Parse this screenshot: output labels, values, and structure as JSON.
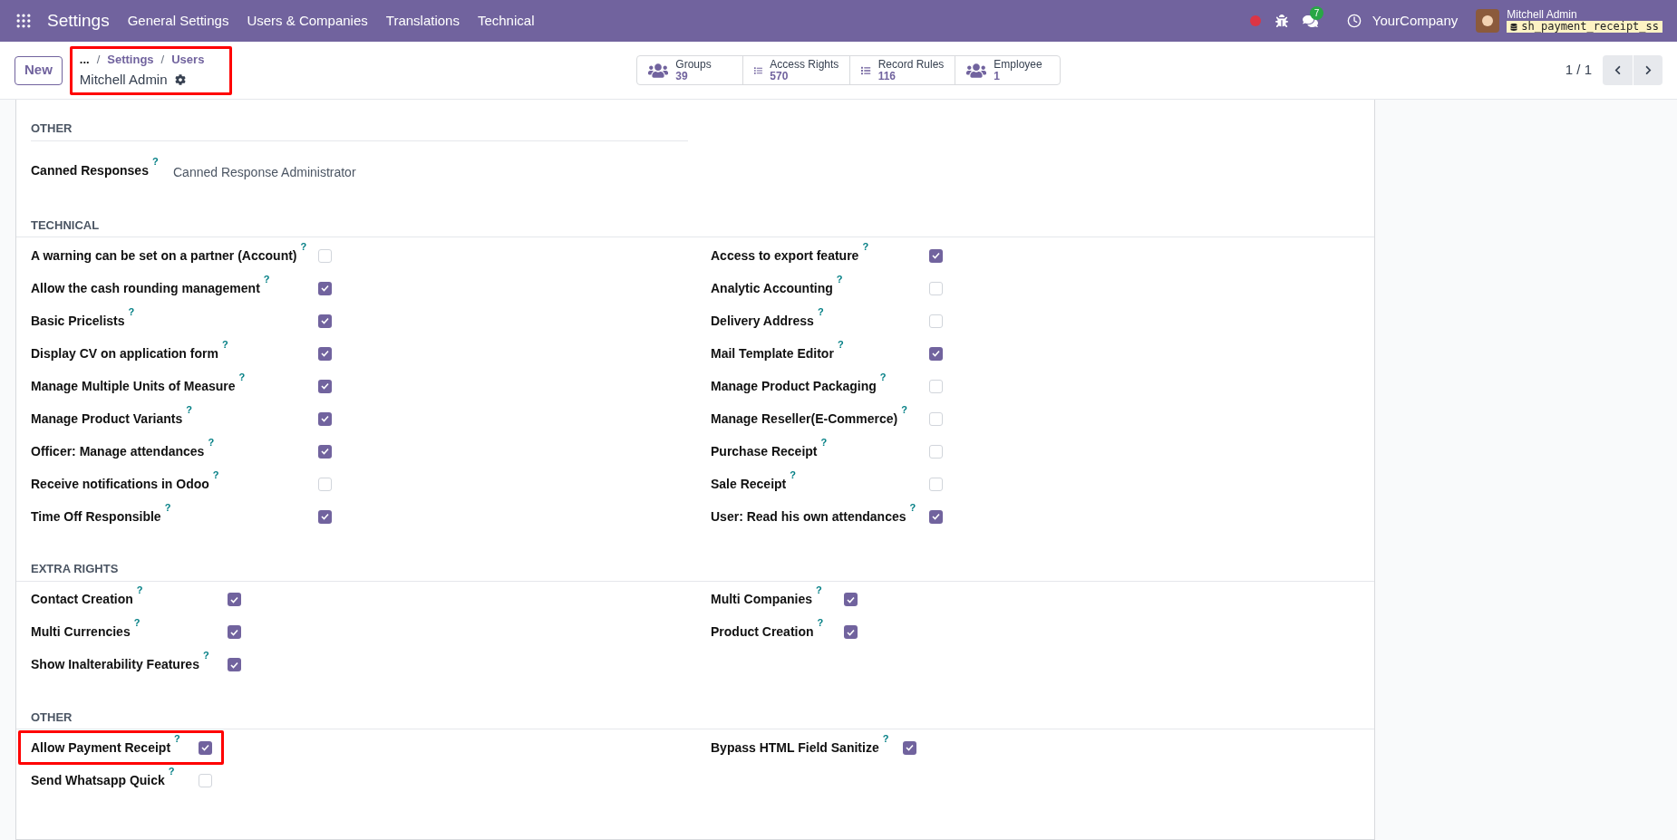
{
  "topbar": {
    "app": "Settings",
    "menu": [
      "General Settings",
      "Users & Companies",
      "Translations",
      "Technical"
    ],
    "chat_count": "7",
    "company": "YourCompany",
    "user": "Mitchell Admin",
    "database": "sh_payment_receipt_ss"
  },
  "control_panel": {
    "new_button": "New",
    "breadcrumb": {
      "highlighted": true,
      "ellipsis": "...",
      "separator": "/",
      "items": [
        "Settings",
        "Users"
      ],
      "current": "Mitchell Admin"
    },
    "smart_buttons": [
      {
        "kind": "users",
        "label": "Groups",
        "count": "39"
      },
      {
        "kind": "list",
        "label": "Access Rights",
        "count": "570"
      },
      {
        "kind": "list",
        "label": "Record Rules",
        "count": "116"
      },
      {
        "kind": "users",
        "label": "Employee",
        "count": "1"
      }
    ],
    "pager": "1 / 1"
  },
  "sections": [
    {
      "title": "OTHER",
      "kind": "field",
      "items": [
        {
          "label": "Canned Responses",
          "help": "?",
          "value": "Canned Response Administrator"
        }
      ]
    },
    {
      "title": "TECHNICAL",
      "kind": "checkboxes",
      "items": [
        {
          "label": "A warning can be set on a partner (Account)",
          "help": "?",
          "checked": false,
          "highlighted": false
        },
        {
          "label": "Access to export feature",
          "help": "?",
          "checked": true,
          "highlighted": false
        },
        {
          "label": "Allow the cash rounding management",
          "help": "?",
          "checked": true,
          "highlighted": false
        },
        {
          "label": "Analytic Accounting",
          "help": "?",
          "checked": false,
          "highlighted": false
        },
        {
          "label": "Basic Pricelists",
          "help": "?",
          "checked": true,
          "highlighted": false
        },
        {
          "label": "Delivery Address",
          "help": "?",
          "checked": false,
          "highlighted": false
        },
        {
          "label": "Display CV on application form",
          "help": "?",
          "checked": true,
          "highlighted": false
        },
        {
          "label": "Mail Template Editor",
          "help": "?",
          "checked": true,
          "highlighted": false
        },
        {
          "label": "Manage Multiple Units of Measure",
          "help": "?",
          "checked": true,
          "highlighted": false
        },
        {
          "label": "Manage Product Packaging",
          "help": "?",
          "checked": false,
          "highlighted": false
        },
        {
          "label": "Manage Product Variants",
          "help": "?",
          "checked": true,
          "highlighted": false
        },
        {
          "label": "Manage Reseller(E-Commerce)",
          "help": "?",
          "checked": false,
          "highlighted": false
        },
        {
          "label": "Officer: Manage attendances",
          "help": "?",
          "checked": true,
          "highlighted": false
        },
        {
          "label": "Purchase Receipt",
          "help": "?",
          "checked": false,
          "highlighted": false
        },
        {
          "label": "Receive notifications in Odoo",
          "help": "?",
          "checked": false,
          "highlighted": false
        },
        {
          "label": "Sale Receipt",
          "help": "?",
          "checked": false,
          "highlighted": false
        },
        {
          "label": "Time Off Responsible",
          "help": "?",
          "checked": true,
          "highlighted": false
        },
        {
          "label": "User: Read his own attendances",
          "help": "?",
          "checked": true,
          "highlighted": false
        }
      ]
    },
    {
      "title": "EXTRA RIGHTS",
      "kind": "checkboxes",
      "items": [
        {
          "label": "Contact Creation",
          "help": "?",
          "checked": true,
          "highlighted": false
        },
        {
          "label": "Multi Companies",
          "help": "?",
          "checked": true,
          "highlighted": false
        },
        {
          "label": "Multi Currencies",
          "help": "?",
          "checked": true,
          "highlighted": false
        },
        {
          "label": "Product Creation",
          "help": "?",
          "checked": true,
          "highlighted": false
        },
        {
          "label": "Show Inalterability Features",
          "help": "?",
          "checked": true,
          "highlighted": false
        }
      ]
    },
    {
      "title": "OTHER",
      "kind": "checkboxes",
      "items": [
        {
          "label": "Allow Payment Receipt",
          "help": "?",
          "checked": true,
          "highlighted": true
        },
        {
          "label": "Bypass HTML Field Sanitize",
          "help": "?",
          "checked": true,
          "highlighted": false
        },
        {
          "label": "Send Whatsapp Quick",
          "help": "?",
          "checked": false,
          "highlighted": false
        }
      ]
    }
  ]
}
